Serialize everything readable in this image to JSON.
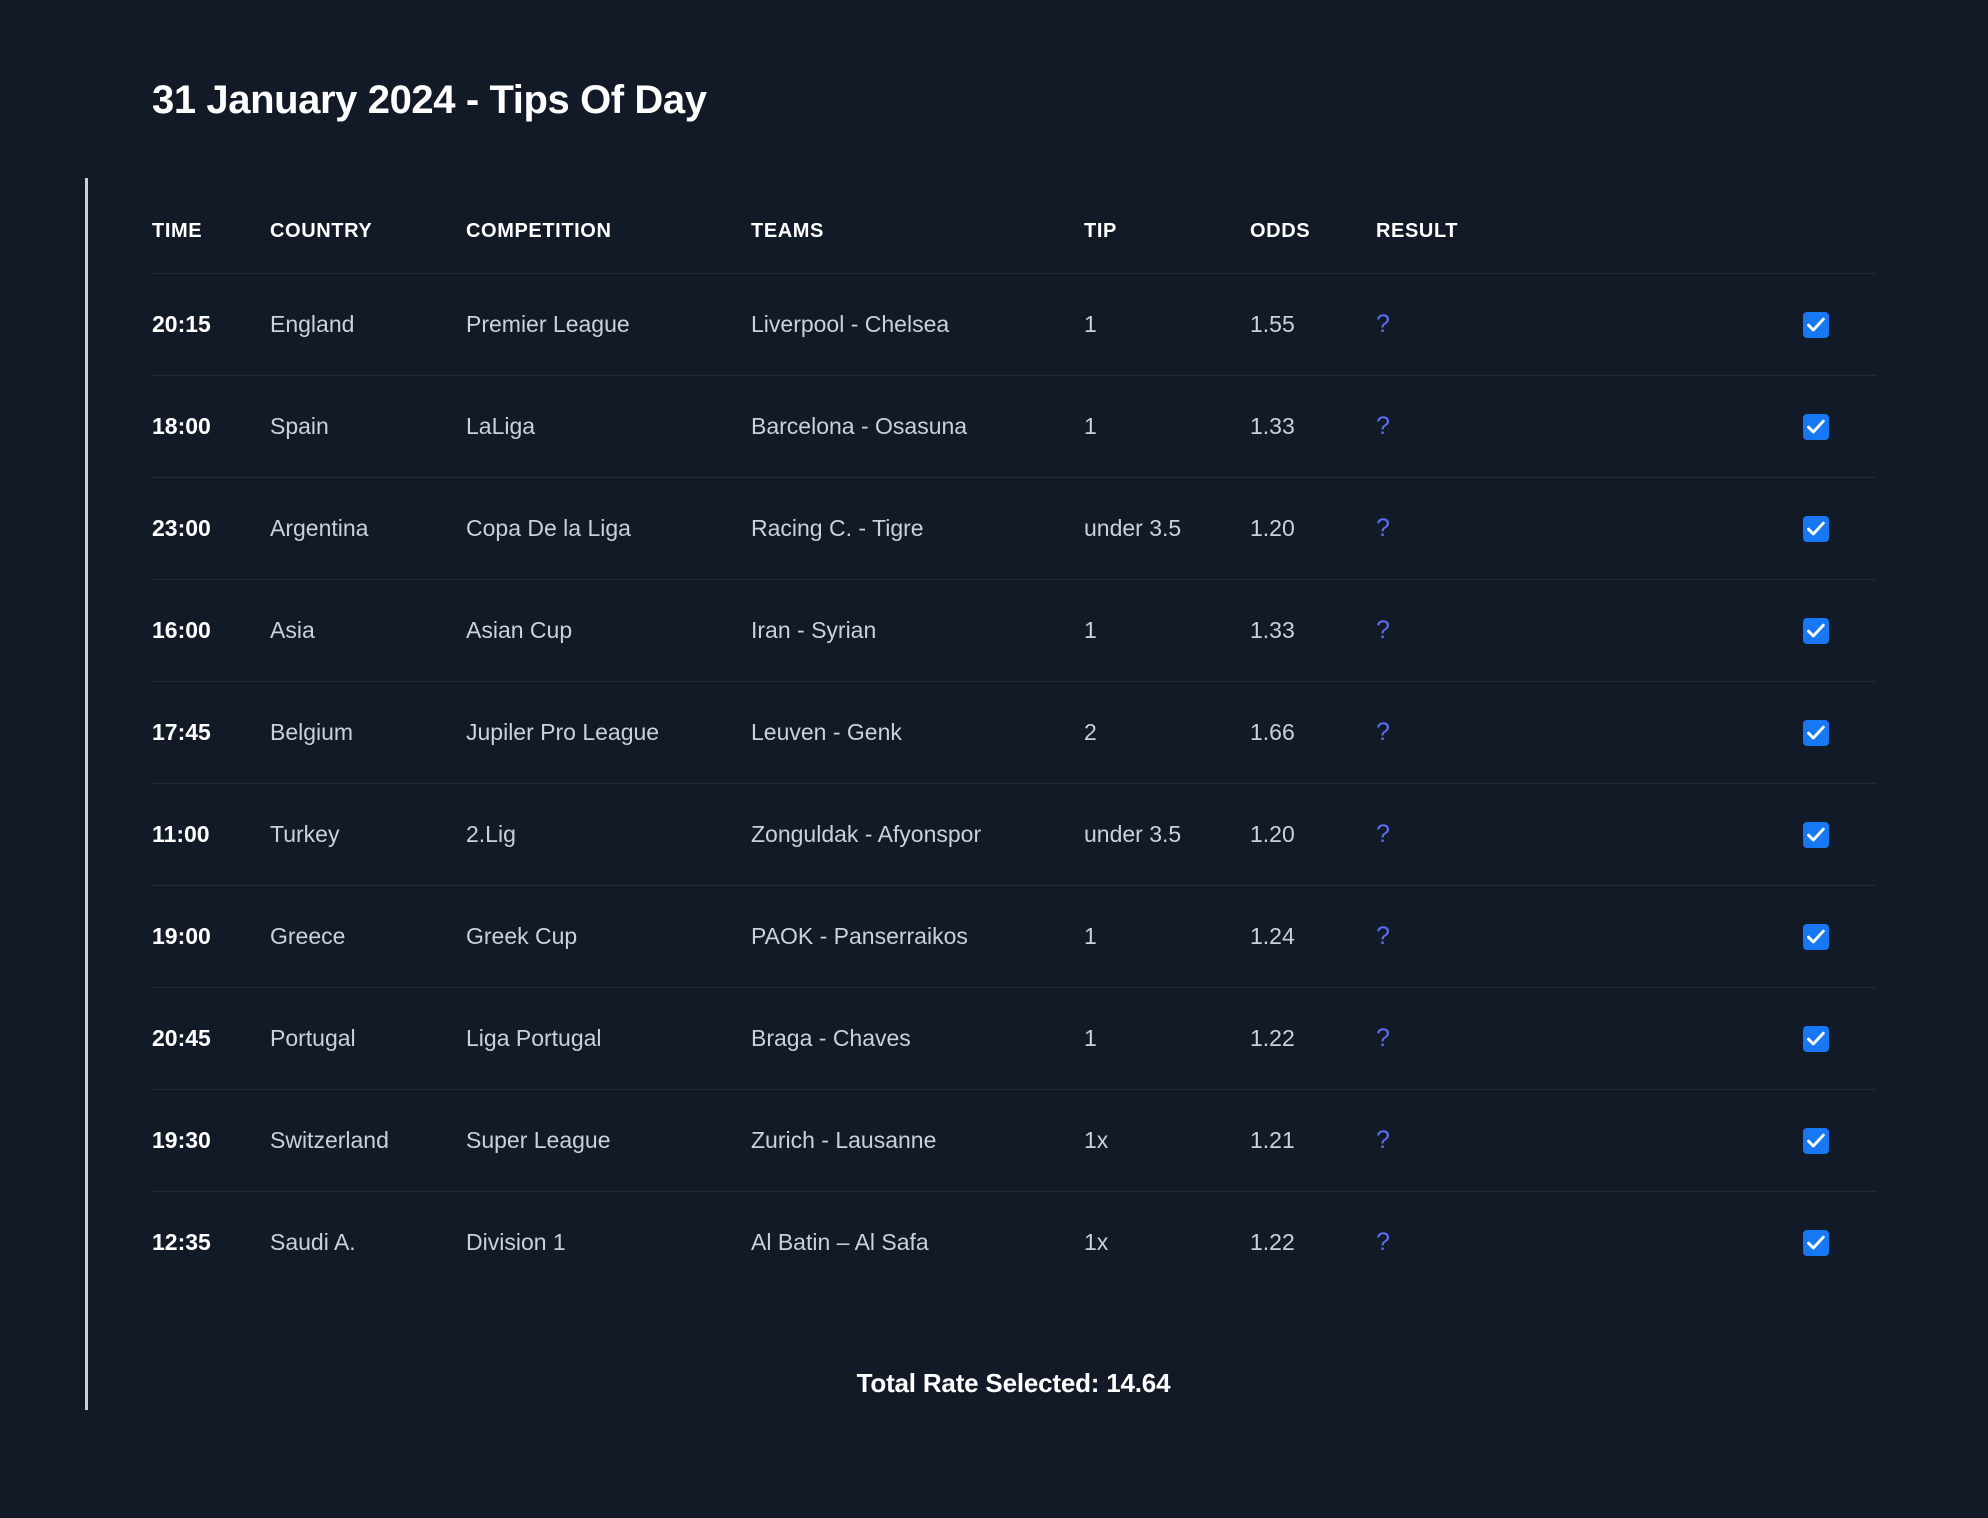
{
  "page": {
    "title": "31 January 2024 - Tips Of Day",
    "background_color": "#131a27",
    "accent_color": "#1877f2",
    "result_color": "#5b6ef5"
  },
  "table": {
    "headers": {
      "time": "TIME",
      "country": "COUNTRY",
      "competition": "COMPETITION",
      "teams": "TEAMS",
      "tip": "TIP",
      "odds": "ODDS",
      "result": "RESULT"
    },
    "rows": [
      {
        "time": "20:15",
        "country": "England",
        "competition": "Premier League",
        "teams": "Liverpool - Chelsea",
        "tip": "1",
        "odds": "1.55",
        "result": "?",
        "checked": true
      },
      {
        "time": "18:00",
        "country": "Spain",
        "competition": "LaLiga",
        "teams": "Barcelona - Osasuna",
        "tip": "1",
        "odds": "1.33",
        "result": "?",
        "checked": true
      },
      {
        "time": "23:00",
        "country": "Argentina",
        "competition": "Copa De la Liga",
        "teams": "Racing C. - Tigre",
        "tip": "under 3.5",
        "odds": "1.20",
        "result": "?",
        "checked": true
      },
      {
        "time": "16:00",
        "country": "Asia",
        "competition": "Asian Cup",
        "teams": "Iran - Syrian",
        "tip": "1",
        "odds": "1.33",
        "result": "?",
        "checked": true
      },
      {
        "time": "17:45",
        "country": "Belgium",
        "competition": "Jupiler Pro League",
        "teams": "Leuven - Genk",
        "tip": "2",
        "odds": "1.66",
        "result": "?",
        "checked": true
      },
      {
        "time": "11:00",
        "country": "Turkey",
        "competition": "2.Lig",
        "teams": "Zonguldak - Afyonspor",
        "tip": "under 3.5",
        "odds": "1.20",
        "result": "?",
        "checked": true
      },
      {
        "time": "19:00",
        "country": "Greece",
        "competition": "Greek Cup",
        "teams": "PAOK - Panserraikos",
        "tip": "1",
        "odds": "1.24",
        "result": "?",
        "checked": true
      },
      {
        "time": "20:45",
        "country": "Portugal",
        "competition": "Liga Portugal",
        "teams": "Braga - Chaves",
        "tip": "1",
        "odds": "1.22",
        "result": "?",
        "checked": true
      },
      {
        "time": "19:30",
        "country": "Switzerland",
        "competition": "Super League",
        "teams": "Zurich - Lausanne",
        "tip": "1x",
        "odds": "1.21",
        "result": "?",
        "checked": true
      },
      {
        "time": "12:35",
        "country": "Saudi A.",
        "competition": "Division 1",
        "teams": "Al Batin – Al Safa",
        "tip": "1x",
        "odds": "1.22",
        "result": "?",
        "checked": true
      }
    ]
  },
  "footer": {
    "total_rate": "Total Rate Selected: 14.64"
  }
}
